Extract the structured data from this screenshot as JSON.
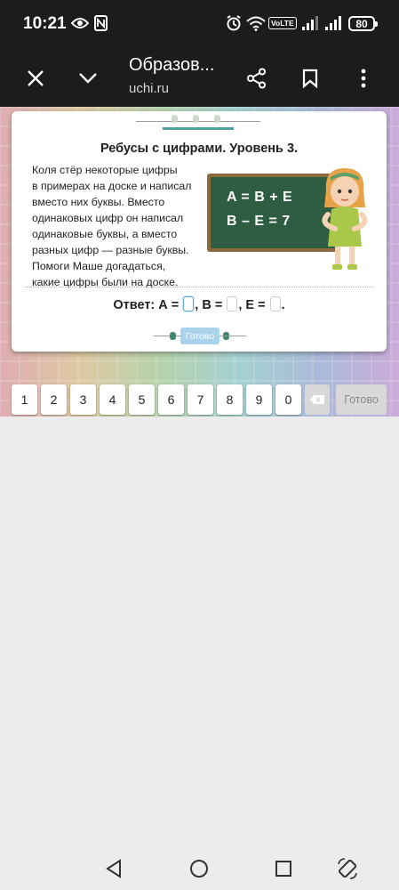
{
  "status": {
    "time": "10:21",
    "battery": "80",
    "volte": "VoLTE"
  },
  "browser": {
    "title": "Образов...",
    "url": "uchi.ru"
  },
  "task": {
    "title": "Ребусы с цифрами. Уровень 3.",
    "lines": [
      "Коля стёр некоторые цифры",
      "в примерах на доске и написал",
      "вместо них буквы. Вместо",
      "одинаковых цифр он написал",
      "одинаковые буквы, а вместо",
      "разных цифр — разные буквы.",
      "Помоги Маше догадаться,",
      "какие цифры были на доске."
    ],
    "board": [
      "A = B + E",
      "B – E = 7"
    ],
    "answer": {
      "label": "Ответ:",
      "a": "А =",
      "b": ", В =",
      "e": ", Е =",
      "end": "."
    },
    "done_small": "Готово"
  },
  "keypad": {
    "keys": [
      "1",
      "2",
      "3",
      "4",
      "5",
      "6",
      "7",
      "8",
      "9",
      "0"
    ],
    "done": "Готово"
  },
  "icons": {
    "close": "close-icon",
    "down": "chevron-down-icon",
    "share": "share-icon",
    "bookmark": "bookmark-icon",
    "menu": "more-vert-icon",
    "back": "backspace-icon"
  },
  "colors": {
    "board": "#2f5d42",
    "accent": "#a9d2ec"
  }
}
